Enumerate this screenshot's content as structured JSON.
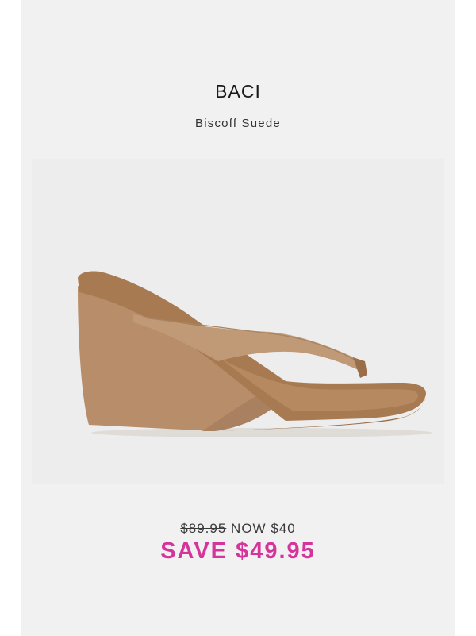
{
  "product": {
    "brand": "BACI",
    "color_name": "Biscoff Suede",
    "image_alt": "sandal-product-image"
  },
  "pricing": {
    "original_price": "$89.95",
    "now_label": "NOW $40",
    "savings": "SAVE $49.95"
  },
  "colors": {
    "card_background": "#f1f1f1",
    "savings_accent": "#d6339b",
    "suede": "#b88e6a",
    "footbed": "#a87a52"
  }
}
